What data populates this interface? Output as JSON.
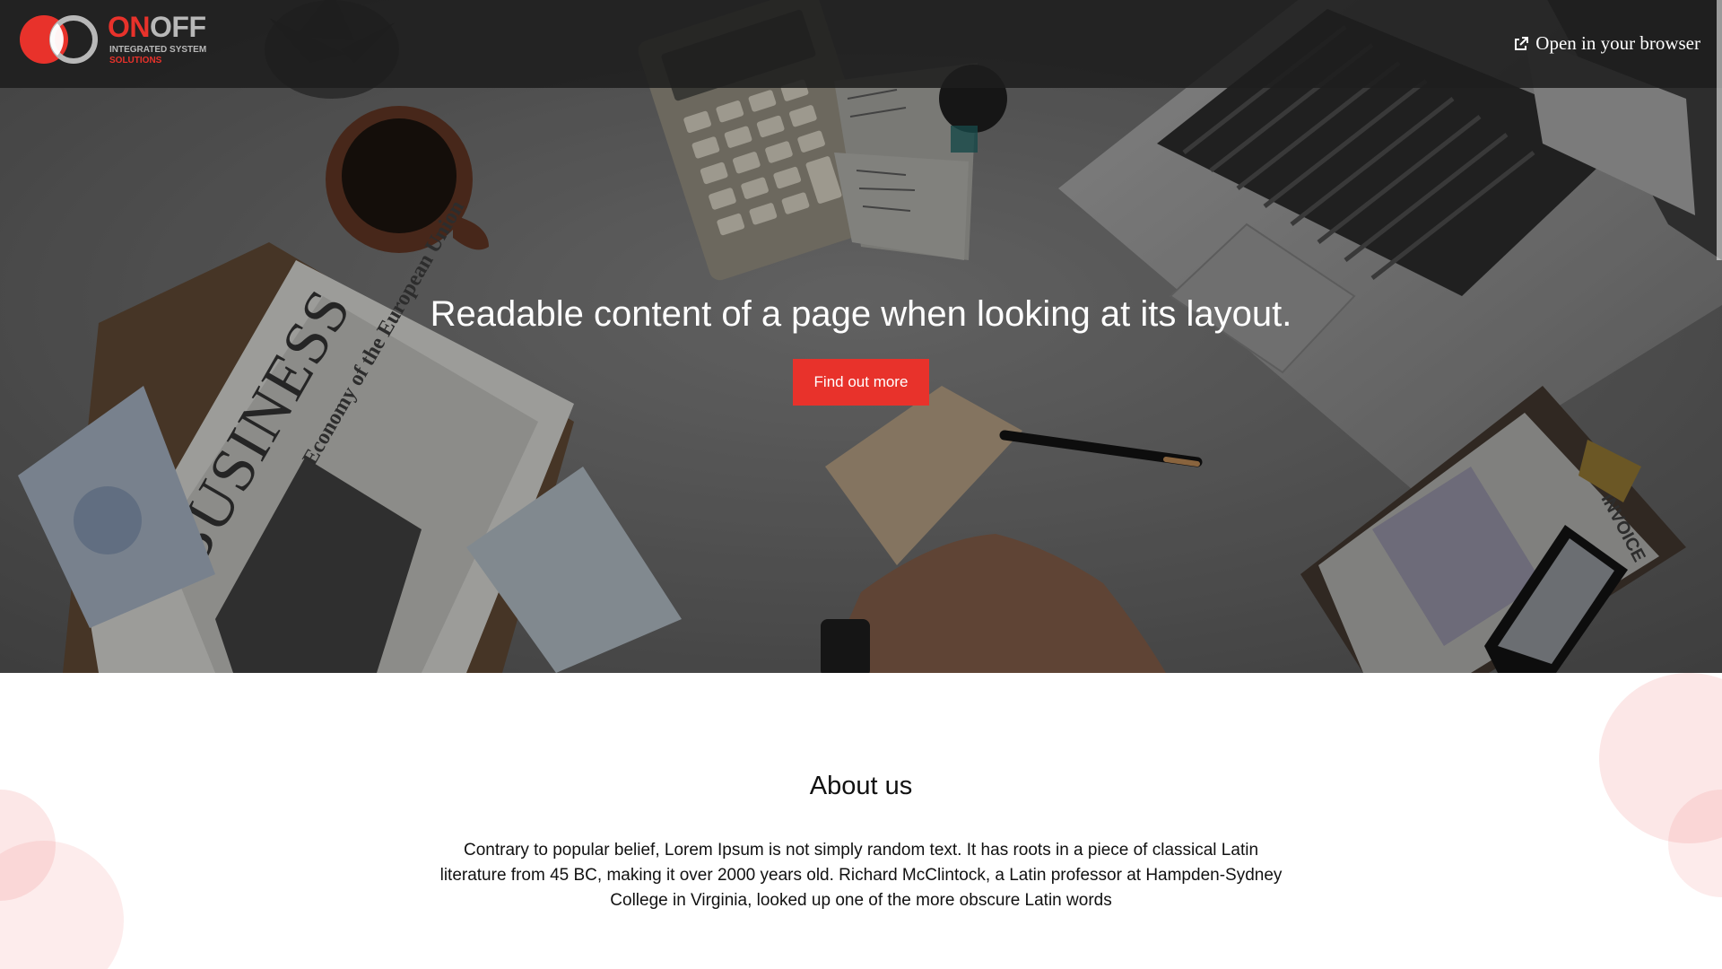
{
  "header": {
    "logo": {
      "word_on": "ON",
      "word_off": "OFF",
      "subtitle_line1": "INTEGRATED SYSTEM",
      "subtitle_line2": "SOLUTIONS"
    },
    "open_browser_label": "Open in your browser",
    "open_browser_icon": "external-link-icon"
  },
  "hero": {
    "headline": "Readable content of a page when looking at its layout.",
    "cta_label": "Find out more",
    "photo_labels": {
      "newspaper_masthead": "BUSINESS",
      "newspaper_headline": "Economy of the European Union",
      "invoice_label": "INVOICE"
    }
  },
  "about": {
    "title": "About us",
    "text": "Contrary to popular belief, Lorem Ipsum is not simply random text. It has roots in a piece of classical Latin literature from 45 BC, making it over 2000 years old. Richard McClintock, a Latin professor at Hampden-Sydney College in Virginia, looked up one of the more obscure Latin words"
  },
  "colors": {
    "brand_red": "#e8322b",
    "topbar_bg": "#1e1e1e",
    "logo_gray": "#b8b8b8",
    "deco_pink": "#f6d6d6"
  }
}
